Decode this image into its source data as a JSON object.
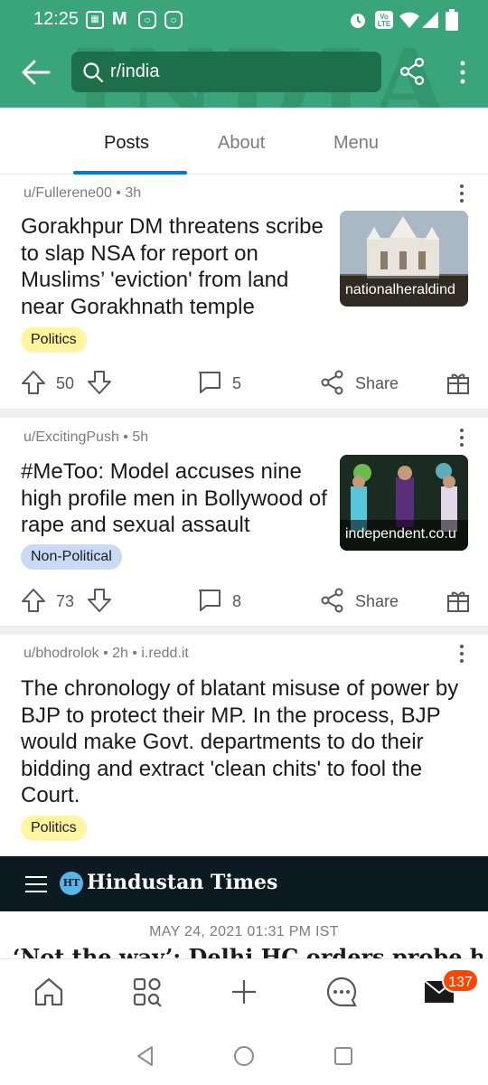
{
  "status_bar": {
    "time": "12:25",
    "indicators": [
      "calendar-icon",
      "gmail-icon",
      "instagram-icon",
      "instagram-icon",
      "alarm-icon",
      "volte-icon",
      "wifi-icon",
      "signal-icon",
      "battery-icon"
    ]
  },
  "header": {
    "search_text": "r/india",
    "accent": "#3aa57a",
    "banner_art": "INDIA"
  },
  "tabs": [
    {
      "label": "Posts",
      "active": true
    },
    {
      "label": "About",
      "active": false
    },
    {
      "label": "Menu",
      "active": false
    }
  ],
  "posts": [
    {
      "meta": "u/Fullerene00 • 3h",
      "title": "Gorakhpur DM threatens scribe to slap NSA for report on Muslims’ 'eviction' from land near Gorakhnath temple",
      "thumb_caption": "nationalheraldind",
      "flair": "Politics",
      "flair_color": "#fff5a0",
      "votes": "50",
      "comments": "5",
      "share": "Share"
    },
    {
      "meta": "u/ExcitingPush • 5h",
      "title": "#MeToo: Model accuses nine high profile men in Bollywood of rape and sexual assault",
      "thumb_caption": "independent.co.u",
      "flair": "Non-Political",
      "flair_color": "#c8daf5",
      "votes": "73",
      "comments": "8",
      "share": "Share"
    },
    {
      "meta": "u/bhodrolok • 2h • i.redd.it",
      "title": "The chronology of blatant misuse of power by BJP to protect their MP. In the process, BJP would make Govt. departments to do their bidding and extract 'clean chits' to fool the Court.",
      "flair": "Politics",
      "flair_color": "#fff5a0"
    }
  ],
  "article": {
    "brand_badge": "HT",
    "brand": "Hindustan Times",
    "date": "MAY 24, 2021 01:31 PM IST",
    "headline_partial": "‘Not the way’: Delhi HC orders probe by"
  },
  "bottom_nav": {
    "inbox_badge": "137",
    "items": [
      "home-icon",
      "communities-icon",
      "create-icon",
      "chat-icon",
      "inbox-icon"
    ]
  }
}
